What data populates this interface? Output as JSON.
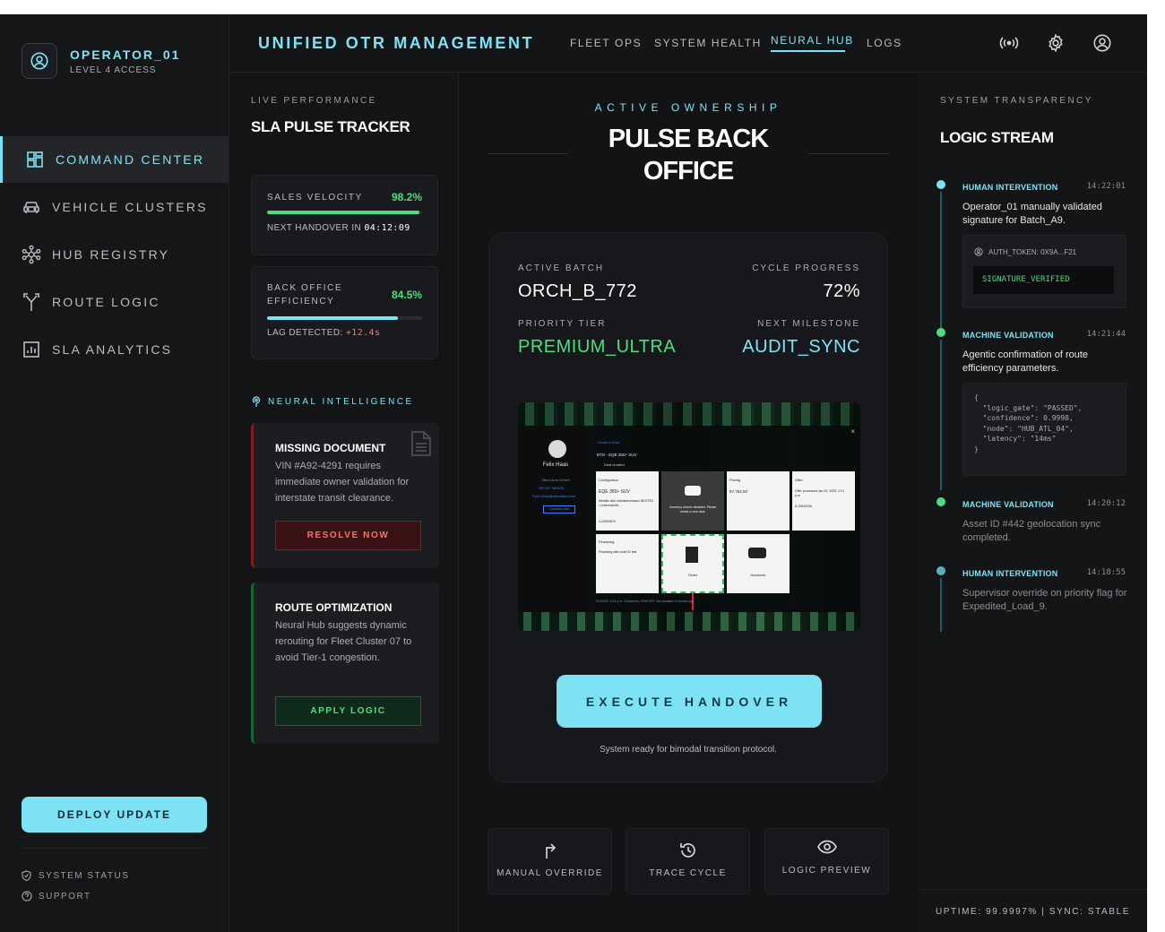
{
  "user": {
    "name": "OPERATOR_01",
    "level": "LEVEL 4 ACCESS"
  },
  "sidebar": {
    "items": [
      {
        "label": "COMMAND CENTER",
        "icon": "dashboard-icon"
      },
      {
        "label": "VEHICLE CLUSTERS",
        "icon": "car-icon"
      },
      {
        "label": "HUB REGISTRY",
        "icon": "hub-icon"
      },
      {
        "label": "ROUTE LOGIC",
        "icon": "fork-icon"
      },
      {
        "label": "SLA ANALYTICS",
        "icon": "chart-icon"
      }
    ],
    "deploy_label": "DEPLOY UPDATE",
    "footer": {
      "status": "SYSTEM STATUS",
      "support": "SUPPORT"
    }
  },
  "header": {
    "brand": "UNIFIED OTR MANAGEMENT",
    "tabs": [
      "FLEET OPS",
      "SYSTEM HEALTH",
      "NEURAL HUB",
      "LOGS"
    ],
    "active_tab": "NEURAL HUB"
  },
  "left": {
    "eyebrow": "LIVE PERFORMANCE",
    "title": "SLA PULSE TRACKER",
    "kpis": [
      {
        "label": "SALES VELOCITY",
        "value": "98.2%",
        "progress": 0.982,
        "sub_label": "NEXT HANDOVER IN",
        "sub_value": "04:12:09"
      },
      {
        "label": "BACK OFFICE EFFICIENCY",
        "value": "84.5%",
        "progress": 0.845,
        "sub_label": "LAG DETECTED:",
        "sub_value": "+12.4s"
      }
    ],
    "neural_label": "NEURAL INTELLIGENCE",
    "alerts": [
      {
        "title": "MISSING DOCUMENT",
        "desc": "VIN #A92-4291 requires immediate owner validation for interstate transit clearance.",
        "button": "RESOLVE NOW"
      },
      {
        "title": "ROUTE OPTIMIZATION",
        "desc": "Neural Hub suggests dynamic rerouting for Fleet Cluster 07 to\navoid Tier-1 congestion.",
        "button": "APPLY LOGIC"
      }
    ]
  },
  "center": {
    "eyebrow": "ACTIVE OWNERSHIP",
    "title_line1": "PULSE BACK",
    "title_line2": "OFFICE",
    "fields": {
      "active_batch_label": "ACTIVE BATCH",
      "active_batch": "ORCH_B_772",
      "cycle_progress_label": "CYCLE PROGRESS",
      "cycle_progress": "72%",
      "priority_tier_label": "PRIORITY TIER",
      "priority_tier": "PREMIUM_ULTRA",
      "next_milestone_label": "NEXT MILESTONE",
      "next_milestone": "AUDIT_SYNC"
    },
    "preview": {
      "contact_name": "Felix Haas",
      "contact_company": "Stern Auto GmbH",
      "contact_phone": "+49 157 389403",
      "contact_email": "Felix.Haas@sternauto.com",
      "contact_button": "Customer data",
      "create_deal": "Create a Deal",
      "deal_title": "BTO - EQE 350+ SUV",
      "deal_status": "Deal created",
      "configurator_title": "Configurator",
      "configurator_model": "EQE 350+ SUV",
      "configurator_desc": "Metallic lack obsidianschwarz NEOTEX / Ledernachbil...",
      "configurator_code": "0-24993579",
      "inventory_text": "Inventory search disabled. Please create a new deal.",
      "pricing_title": "Pricing",
      "pricing_value": "87.762,50",
      "offer_title": "Offer",
      "offer_text": "Offer processed Jan 29, 2025, 2:13 p.m",
      "offer_code": "A-29443426",
      "financing_title": "Financing",
      "financing_text": "Financing with route ID test",
      "order_label": "Order",
      "handover_label": "Handover",
      "footer_text": "01/29/25, 4:24 p.m. Created by XSHKOFF, last updated 3 minutes ago"
    },
    "execute_label": "EXECUTE HANDOVER",
    "ready_text": "System ready for bimodal transition protocol.",
    "actions": [
      "MANUAL OVERRIDE",
      "TRACE CYCLE",
      "LOGIC PREVIEW"
    ]
  },
  "right": {
    "eyebrow": "SYSTEM TRANSPARENCY",
    "title": "LOGIC STREAM",
    "events": [
      {
        "type": "HUMAN INTERVENTION",
        "time": "14:22:01",
        "desc": "Operator_01 manually validated signature for Batch_A9.",
        "token_label": "AUTH_TOKEN: 0X9A...F21",
        "token_status": "SIGNATURE_VERIFIED"
      },
      {
        "type": "MACHINE VALIDATION",
        "time": "14:21:44",
        "desc": "Agentic confirmation of route efficiency parameters.",
        "code": "{\n  \"logic_gate\": \"PASSED\",\n  \"confidence\": 0.9998,\n  \"node\": \"HUB_ATL_04\",\n  \"latency\": \"14ms\"\n}"
      },
      {
        "type": "MACHINE VALIDATION",
        "time": "14:20:12",
        "desc": "Asset ID #442 geolocation sync completed."
      },
      {
        "type": "HUMAN INTERVENTION",
        "time": "14:18:55",
        "desc": "Supervisor override on priority flag for Expedited_Load_9."
      }
    ],
    "uptime": "UPTIME: 99.9997% | SYNC: STABLE"
  },
  "colors": {
    "accent": "#7de3f4",
    "success": "#4ade80",
    "danger": "#f87171",
    "danger_border": "#7f1d1d",
    "success_border": "#166534"
  }
}
